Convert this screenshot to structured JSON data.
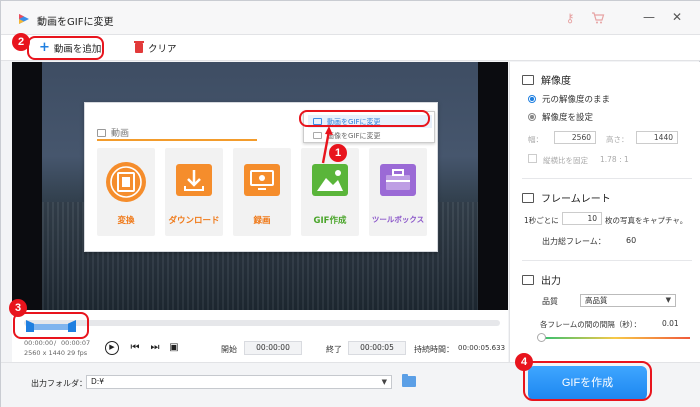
{
  "window": {
    "title": "動画をGIFに変更"
  },
  "titlebar_icons": {
    "key_icon": "⚷",
    "cart_icon": "🛒",
    "minimize": "—",
    "close": "✕"
  },
  "toolbar": {
    "add_label": "動画を追加",
    "clear_label": "クリア"
  },
  "menu": {
    "header": "動画",
    "tiles": [
      {
        "label": "変換",
        "icon": "film-icon"
      },
      {
        "label": "ダウンロード",
        "icon": "download-icon"
      },
      {
        "label": "録画",
        "icon": "monitor-icon"
      },
      {
        "label": "GIF作成",
        "icon": "image-icon"
      },
      {
        "label": "ツールボックス",
        "icon": "toolbox-icon"
      }
    ],
    "dropdown": {
      "selected": "動画をGIFに変更",
      "other": "画像をGIFに変更"
    }
  },
  "player": {
    "time_current": "00:00:00",
    "time_total": "00:00:07",
    "resolution": "2560 x 1440",
    "fps": "29 fps",
    "start_label": "開始",
    "start_value": "00:00:00",
    "end_label": "終了",
    "end_value": "00:00:05",
    "duration_label": "持続時間：",
    "duration_value": "00:00:05.633"
  },
  "resolution_section": {
    "title": "解像度",
    "opt_keep": "元の解像度のまま",
    "opt_set": "解像度を設定",
    "width_label": "幅：",
    "width_value": "2560",
    "height_label": "高さ：",
    "height_value": "1440",
    "aspect_label": "縦横比を固定",
    "aspect_value": "1.78 : 1"
  },
  "framerate_section": {
    "title": "フレームレート",
    "per_label": "1秒ごとに",
    "per_value": "10",
    "per_suffix": "枚の写真をキャプチャ。",
    "total_label": "出力総フレーム：",
    "total_value": "60"
  },
  "output_section": {
    "title": "出力",
    "quality_label": "品質",
    "quality_value": "高品質",
    "interval_label": "各フレームの間の間隔（秒）：",
    "interval_value": "0.01"
  },
  "bottom": {
    "folder_label": "出力フォルダ：",
    "folder_value": "D:¥",
    "create_button": "GIFを作成"
  },
  "callouts": [
    "1",
    "2",
    "3",
    "4"
  ],
  "colors": {
    "accent": "#1f7fe0",
    "callout_red": "#e8141d",
    "orange": "#f58d2c"
  }
}
